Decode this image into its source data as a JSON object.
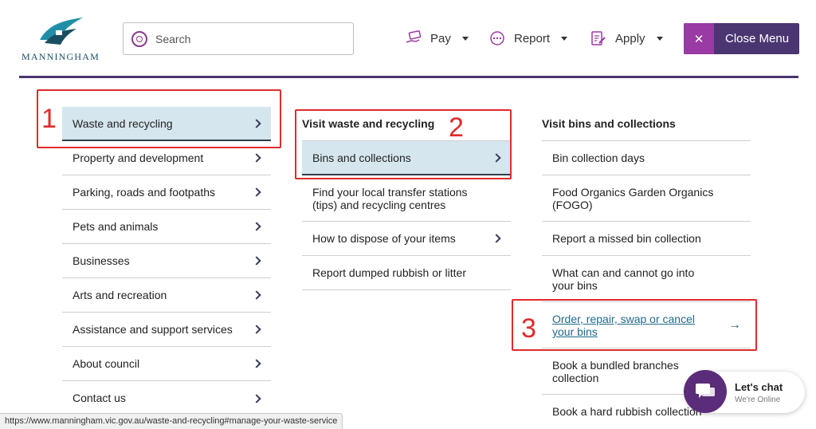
{
  "header": {
    "logo_text": "MANNINGHAM",
    "search_placeholder": "Search",
    "nav": [
      {
        "label": "Pay"
      },
      {
        "label": "Report"
      },
      {
        "label": "Apply"
      }
    ],
    "close_menu_label": "Close Menu",
    "close_menu_x": "✕"
  },
  "column1": {
    "items": [
      {
        "label": "Waste and recycling"
      },
      {
        "label": "Property and development"
      },
      {
        "label": "Parking, roads and footpaths"
      },
      {
        "label": "Pets and animals"
      },
      {
        "label": "Businesses"
      },
      {
        "label": "Arts and recreation"
      },
      {
        "label": "Assistance and support services"
      },
      {
        "label": "About council"
      },
      {
        "label": "Contact us"
      }
    ]
  },
  "column2": {
    "heading": "Visit waste and recycling",
    "items": [
      {
        "label": "Bins and collections"
      },
      {
        "label": "Find your local transfer stations (tips) and recycling centres"
      },
      {
        "label": "How to dispose of your items"
      },
      {
        "label": "Report dumped rubbish or litter"
      }
    ]
  },
  "column3": {
    "heading": "Visit bins and collections",
    "items": [
      {
        "label": "Bin collection days"
      },
      {
        "label": "Food Organics Garden Organics (FOGO)"
      },
      {
        "label": "Report a missed bin collection"
      },
      {
        "label": "What can and cannot go into your bins"
      },
      {
        "label": "Order, repair, swap or cancel your bins"
      },
      {
        "label": "Book a bundled branches collection"
      },
      {
        "label": "Book a hard rubbish collection"
      }
    ]
  },
  "annotations": [
    "1",
    "2",
    "3"
  ],
  "chat": {
    "title": "Let's chat",
    "subtitle": "We're Online"
  },
  "status_url": "https://www.manningham.vic.gov.au/waste-and-recycling#manage-your-waste-service",
  "colors": {
    "brand_purple": "#4a3670",
    "accent_magenta": "#9a3aa4",
    "active_bg": "#d6e6ee",
    "annotation_red": "#e02b2b",
    "link_blue": "#1f6a8c"
  }
}
